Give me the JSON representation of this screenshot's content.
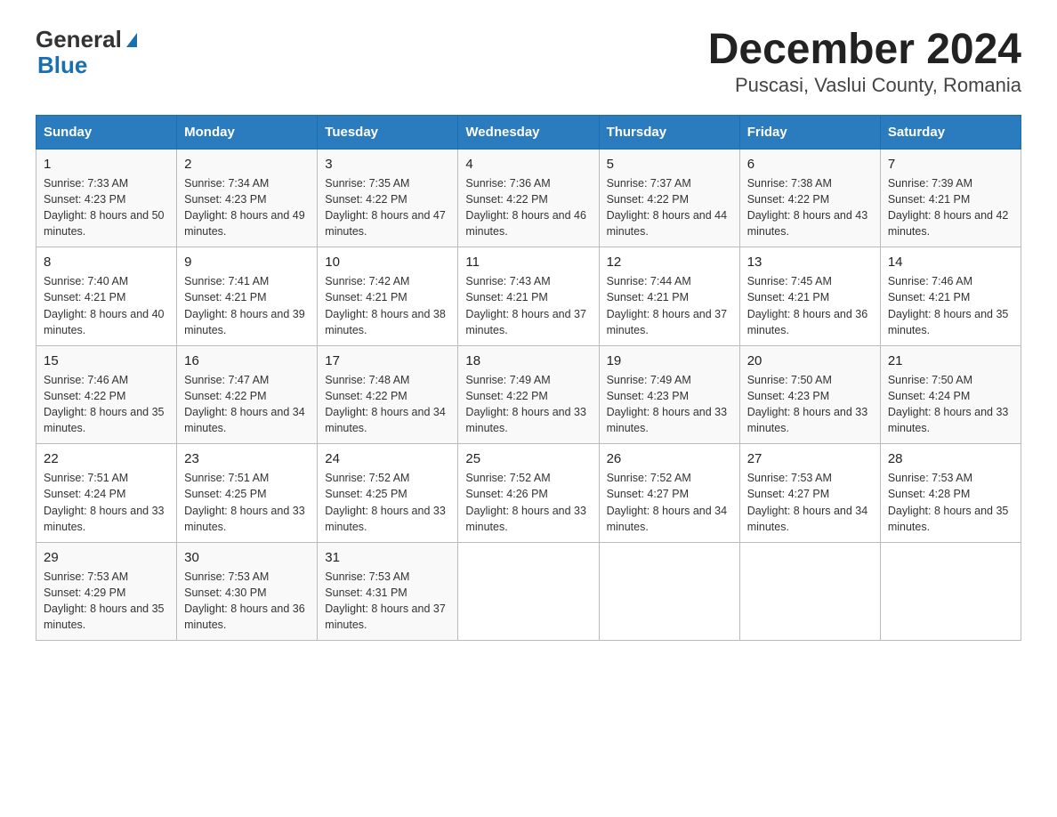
{
  "header": {
    "logo_general": "General",
    "logo_blue": "Blue",
    "title": "December 2024",
    "subtitle": "Puscasi, Vaslui County, Romania"
  },
  "days_of_week": [
    "Sunday",
    "Monday",
    "Tuesday",
    "Wednesday",
    "Thursday",
    "Friday",
    "Saturday"
  ],
  "weeks": [
    [
      {
        "day": "1",
        "sunrise": "7:33 AM",
        "sunset": "4:23 PM",
        "daylight": "8 hours and 50 minutes."
      },
      {
        "day": "2",
        "sunrise": "7:34 AM",
        "sunset": "4:23 PM",
        "daylight": "8 hours and 49 minutes."
      },
      {
        "day": "3",
        "sunrise": "7:35 AM",
        "sunset": "4:22 PM",
        "daylight": "8 hours and 47 minutes."
      },
      {
        "day": "4",
        "sunrise": "7:36 AM",
        "sunset": "4:22 PM",
        "daylight": "8 hours and 46 minutes."
      },
      {
        "day": "5",
        "sunrise": "7:37 AM",
        "sunset": "4:22 PM",
        "daylight": "8 hours and 44 minutes."
      },
      {
        "day": "6",
        "sunrise": "7:38 AM",
        "sunset": "4:22 PM",
        "daylight": "8 hours and 43 minutes."
      },
      {
        "day": "7",
        "sunrise": "7:39 AM",
        "sunset": "4:21 PM",
        "daylight": "8 hours and 42 minutes."
      }
    ],
    [
      {
        "day": "8",
        "sunrise": "7:40 AM",
        "sunset": "4:21 PM",
        "daylight": "8 hours and 40 minutes."
      },
      {
        "day": "9",
        "sunrise": "7:41 AM",
        "sunset": "4:21 PM",
        "daylight": "8 hours and 39 minutes."
      },
      {
        "day": "10",
        "sunrise": "7:42 AM",
        "sunset": "4:21 PM",
        "daylight": "8 hours and 38 minutes."
      },
      {
        "day": "11",
        "sunrise": "7:43 AM",
        "sunset": "4:21 PM",
        "daylight": "8 hours and 37 minutes."
      },
      {
        "day": "12",
        "sunrise": "7:44 AM",
        "sunset": "4:21 PM",
        "daylight": "8 hours and 37 minutes."
      },
      {
        "day": "13",
        "sunrise": "7:45 AM",
        "sunset": "4:21 PM",
        "daylight": "8 hours and 36 minutes."
      },
      {
        "day": "14",
        "sunrise": "7:46 AM",
        "sunset": "4:21 PM",
        "daylight": "8 hours and 35 minutes."
      }
    ],
    [
      {
        "day": "15",
        "sunrise": "7:46 AM",
        "sunset": "4:22 PM",
        "daylight": "8 hours and 35 minutes."
      },
      {
        "day": "16",
        "sunrise": "7:47 AM",
        "sunset": "4:22 PM",
        "daylight": "8 hours and 34 minutes."
      },
      {
        "day": "17",
        "sunrise": "7:48 AM",
        "sunset": "4:22 PM",
        "daylight": "8 hours and 34 minutes."
      },
      {
        "day": "18",
        "sunrise": "7:49 AM",
        "sunset": "4:22 PM",
        "daylight": "8 hours and 33 minutes."
      },
      {
        "day": "19",
        "sunrise": "7:49 AM",
        "sunset": "4:23 PM",
        "daylight": "8 hours and 33 minutes."
      },
      {
        "day": "20",
        "sunrise": "7:50 AM",
        "sunset": "4:23 PM",
        "daylight": "8 hours and 33 minutes."
      },
      {
        "day": "21",
        "sunrise": "7:50 AM",
        "sunset": "4:24 PM",
        "daylight": "8 hours and 33 minutes."
      }
    ],
    [
      {
        "day": "22",
        "sunrise": "7:51 AM",
        "sunset": "4:24 PM",
        "daylight": "8 hours and 33 minutes."
      },
      {
        "day": "23",
        "sunrise": "7:51 AM",
        "sunset": "4:25 PM",
        "daylight": "8 hours and 33 minutes."
      },
      {
        "day": "24",
        "sunrise": "7:52 AM",
        "sunset": "4:25 PM",
        "daylight": "8 hours and 33 minutes."
      },
      {
        "day": "25",
        "sunrise": "7:52 AM",
        "sunset": "4:26 PM",
        "daylight": "8 hours and 33 minutes."
      },
      {
        "day": "26",
        "sunrise": "7:52 AM",
        "sunset": "4:27 PM",
        "daylight": "8 hours and 34 minutes."
      },
      {
        "day": "27",
        "sunrise": "7:53 AM",
        "sunset": "4:27 PM",
        "daylight": "8 hours and 34 minutes."
      },
      {
        "day": "28",
        "sunrise": "7:53 AM",
        "sunset": "4:28 PM",
        "daylight": "8 hours and 35 minutes."
      }
    ],
    [
      {
        "day": "29",
        "sunrise": "7:53 AM",
        "sunset": "4:29 PM",
        "daylight": "8 hours and 35 minutes."
      },
      {
        "day": "30",
        "sunrise": "7:53 AM",
        "sunset": "4:30 PM",
        "daylight": "8 hours and 36 minutes."
      },
      {
        "day": "31",
        "sunrise": "7:53 AM",
        "sunset": "4:31 PM",
        "daylight": "8 hours and 37 minutes."
      },
      null,
      null,
      null,
      null
    ]
  ]
}
